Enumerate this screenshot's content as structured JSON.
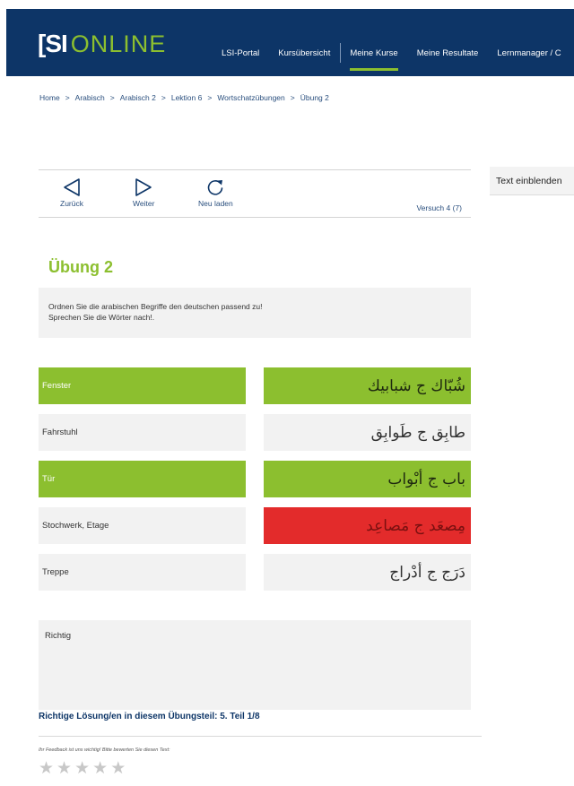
{
  "header": {
    "logo_mark": "[SI",
    "logo_text": "ONLINE",
    "nav": [
      {
        "label": "LSI-Portal"
      },
      {
        "label": "Kursübersicht"
      },
      {
        "label": "Meine Kurse"
      },
      {
        "label": "Meine Resultate"
      },
      {
        "label": "Lernmanager / C"
      }
    ]
  },
  "breadcrumb": [
    "Home",
    "Arabisch",
    "Arabisch 2",
    "Lektion 6",
    "Wortschatzübungen",
    "Übung 2"
  ],
  "breadcrumb_sep": ">",
  "toolbar": {
    "back_label": "Zurück",
    "next_label": "Weiter",
    "reload_label": "Neu laden",
    "attempt": "Versuch 4 (7)"
  },
  "side": {
    "show_text_label": "Text einblenden"
  },
  "exercise": {
    "title": "Übung 2",
    "instructions": [
      "Ordnen Sie die arabischen Begriffe den deutschen passend zu!",
      "Sprechen Sie die Wörter nach!."
    ],
    "pairs": [
      {
        "german": "Fenster",
        "arabic": "شُبّاك ج شبابيك",
        "left_state": "correct",
        "right_state": "correct"
      },
      {
        "german": "Fahrstuhl",
        "arabic": "طابِق ج طَوابِق",
        "left_state": "neutral",
        "right_state": "neutral"
      },
      {
        "german": "Tür",
        "arabic": "باب ج أبْواب",
        "left_state": "correct",
        "right_state": "correct"
      },
      {
        "german": "Stochwerk, Etage",
        "arabic": "مِصعَد ج مَصاعِد",
        "left_state": "neutral",
        "right_state": "wrong"
      },
      {
        "german": "Treppe",
        "arabic": "دَرَج ج أدْراج",
        "left_state": "neutral",
        "right_state": "neutral"
      }
    ],
    "result_text": "Richtig",
    "solution_text": "Richtige Lösung/en in diesem Übungsteil: 5. Teil 1/8"
  },
  "feedback": {
    "prompt": "Ihr Feedback ist uns wichtig! Bitte bewerten Sie diesen Text:",
    "rating": 0,
    "max_rating": 5
  },
  "colors": {
    "header_bg": "#0d3567",
    "accent_green": "#8cbf2f",
    "wrong_red": "#e32b2b",
    "panel_grey": "#f2f2f2"
  }
}
